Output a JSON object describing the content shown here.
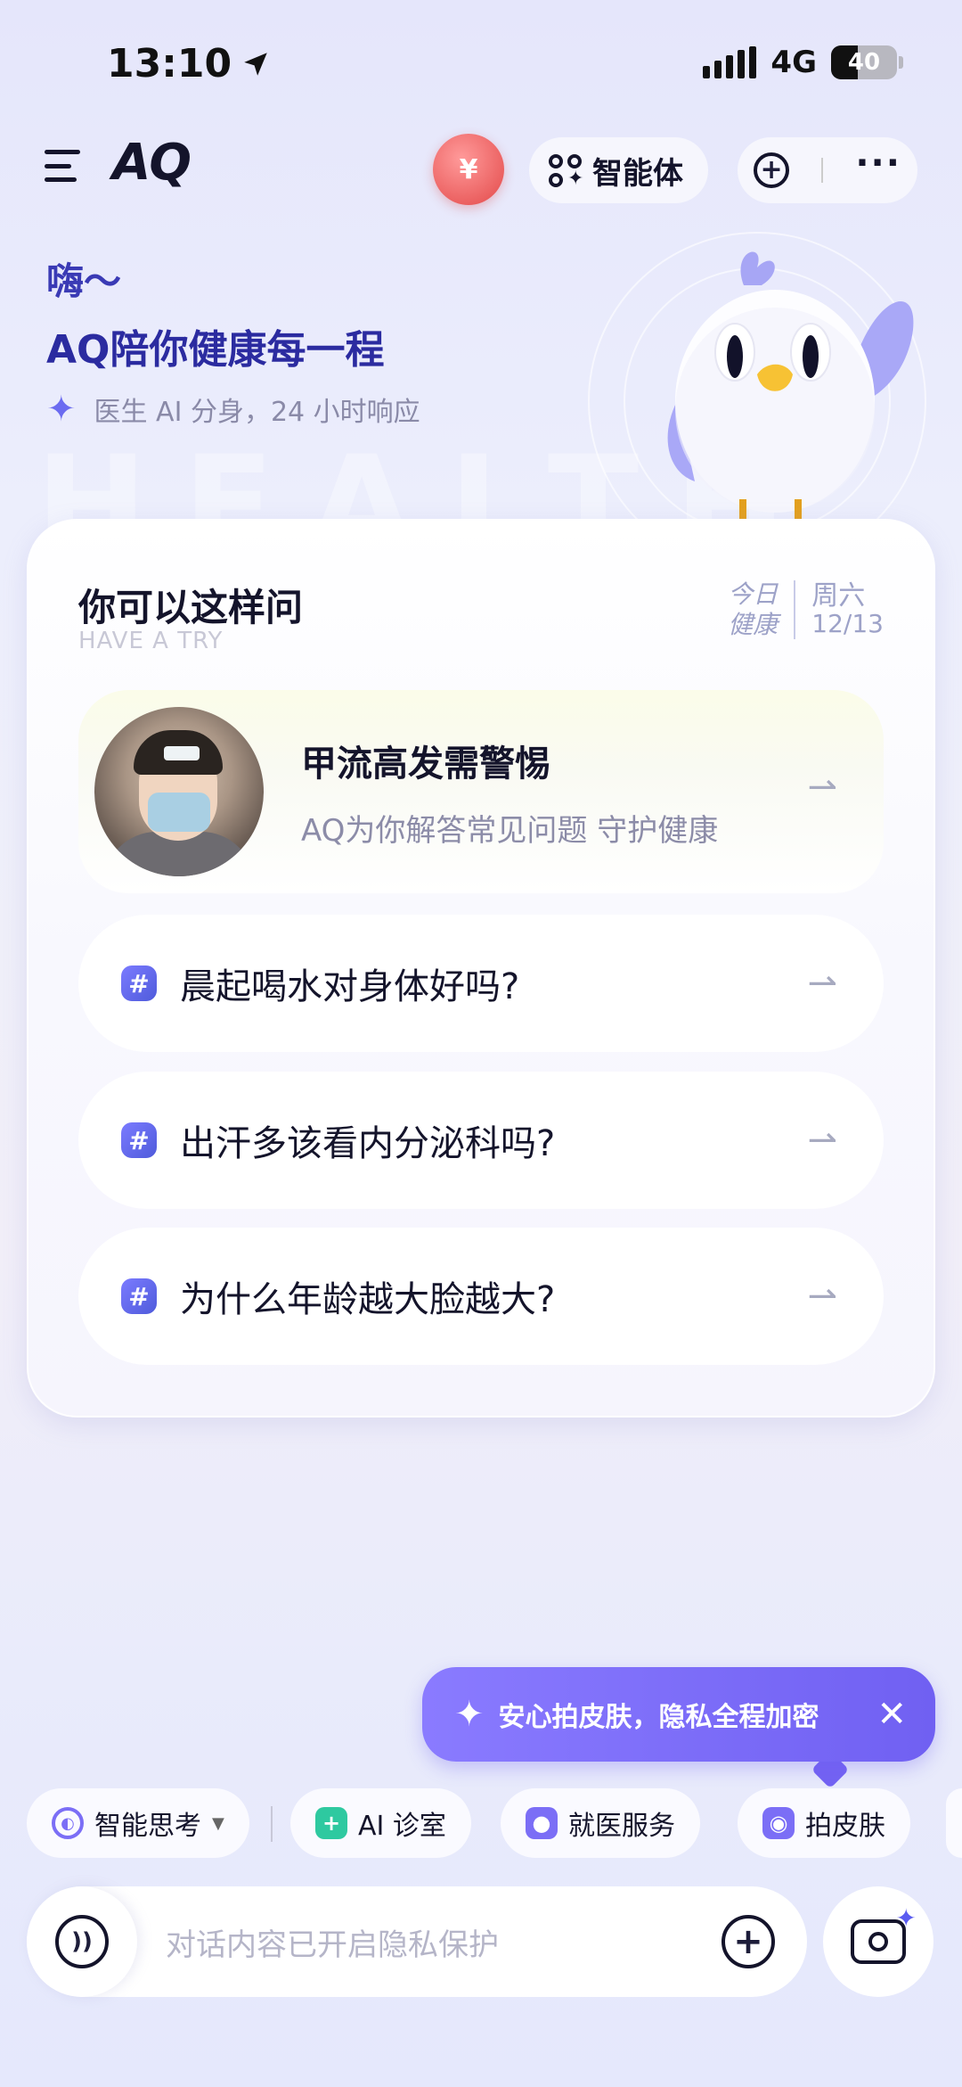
{
  "status_bar": {
    "time": "13:10",
    "network": "4G",
    "battery": "40"
  },
  "header": {
    "app_name": "AQ",
    "gift_label": "¥",
    "agent_label": "智能体"
  },
  "greeting": {
    "line1": "嗨～",
    "line2": "AQ陪你健康每一程",
    "line3": "医生 AI 分身，24 小时响应"
  },
  "card": {
    "title": "你可以这样问",
    "subtitle": "HAVE A TRY",
    "date_left": [
      "今日",
      "健康"
    ],
    "weekday": "周六",
    "date": "12/13",
    "featured": {
      "title": "甲流高发需警惕",
      "desc": "AQ为你解答常见问题 守护健康"
    },
    "questions": [
      {
        "text": "晨起喝水对身体好吗?"
      },
      {
        "text": "出汗多该看内分泌科吗?"
      },
      {
        "text": "为什么年龄越大脸越大?"
      }
    ]
  },
  "tooltip": {
    "text": "安心拍皮肤，隐私全程加密"
  },
  "chips": [
    {
      "label": "智能思考"
    },
    {
      "label": "AI 诊室"
    },
    {
      "label": "就医服务"
    },
    {
      "label": "拍皮肤"
    }
  ],
  "input": {
    "placeholder": "对话内容已开启隐私保护"
  },
  "colors": {
    "accent": "#7060f2",
    "title_blue": "#2b2ba0",
    "chip_green": "#2ec9a0",
    "chip_purple": "#7b6ef6"
  }
}
